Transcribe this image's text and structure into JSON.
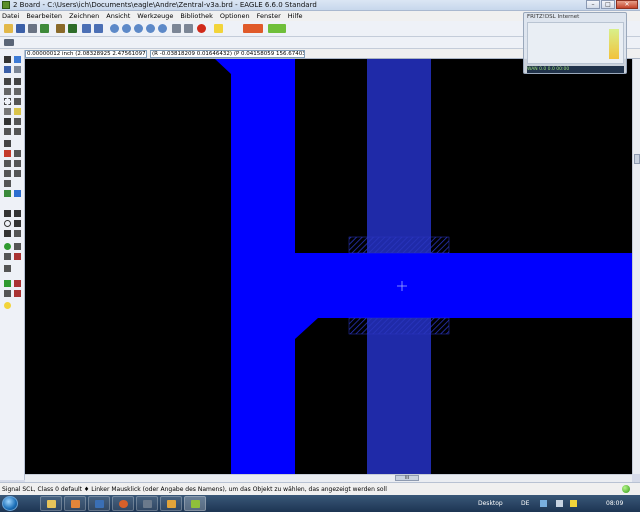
{
  "window": {
    "title": "2 Board - C:\\Users\\ich\\Documents\\eagle\\Andre\\Zentral-v3a.brd - EAGLE 6.6.0 Standard",
    "minimize_label": "–",
    "maximize_label": "□",
    "close_label": "✕"
  },
  "menu": {
    "items": [
      "Datei",
      "Bearbeiten",
      "Zeichnen",
      "Ansicht",
      "Werkzeuge",
      "Bibliothek",
      "Optionen",
      "Fenster",
      "Hilfe"
    ]
  },
  "coords": {
    "grid": "0.00000012 inch (2.08328925 2.47561097)",
    "polar": "(R -0.03818209 0.01646432) (P 0.04158059 156.67403499°)"
  },
  "canvas": {
    "background": "#000000",
    "trace_color": "#0000ff",
    "track_color": "#1f2aa8"
  },
  "status": {
    "text": "Signal SCL, Class 0 default  ♦ Linker Mausklick (oder Angabe des Namens), um das Objekt zu wählen, das angezeigt werden soll"
  },
  "widget": {
    "title": "FRITZ!DSL Internet",
    "footer": "WAN   0.0   0.0   00:00"
  },
  "taskbar": {
    "desktop_label": "Desktop",
    "lang": "DE",
    "clock": "08:09"
  },
  "hscroll_thumb_label": "III",
  "icons": [
    "stop-icon",
    "help-icon",
    "design-link-icon",
    "cam-icon"
  ]
}
